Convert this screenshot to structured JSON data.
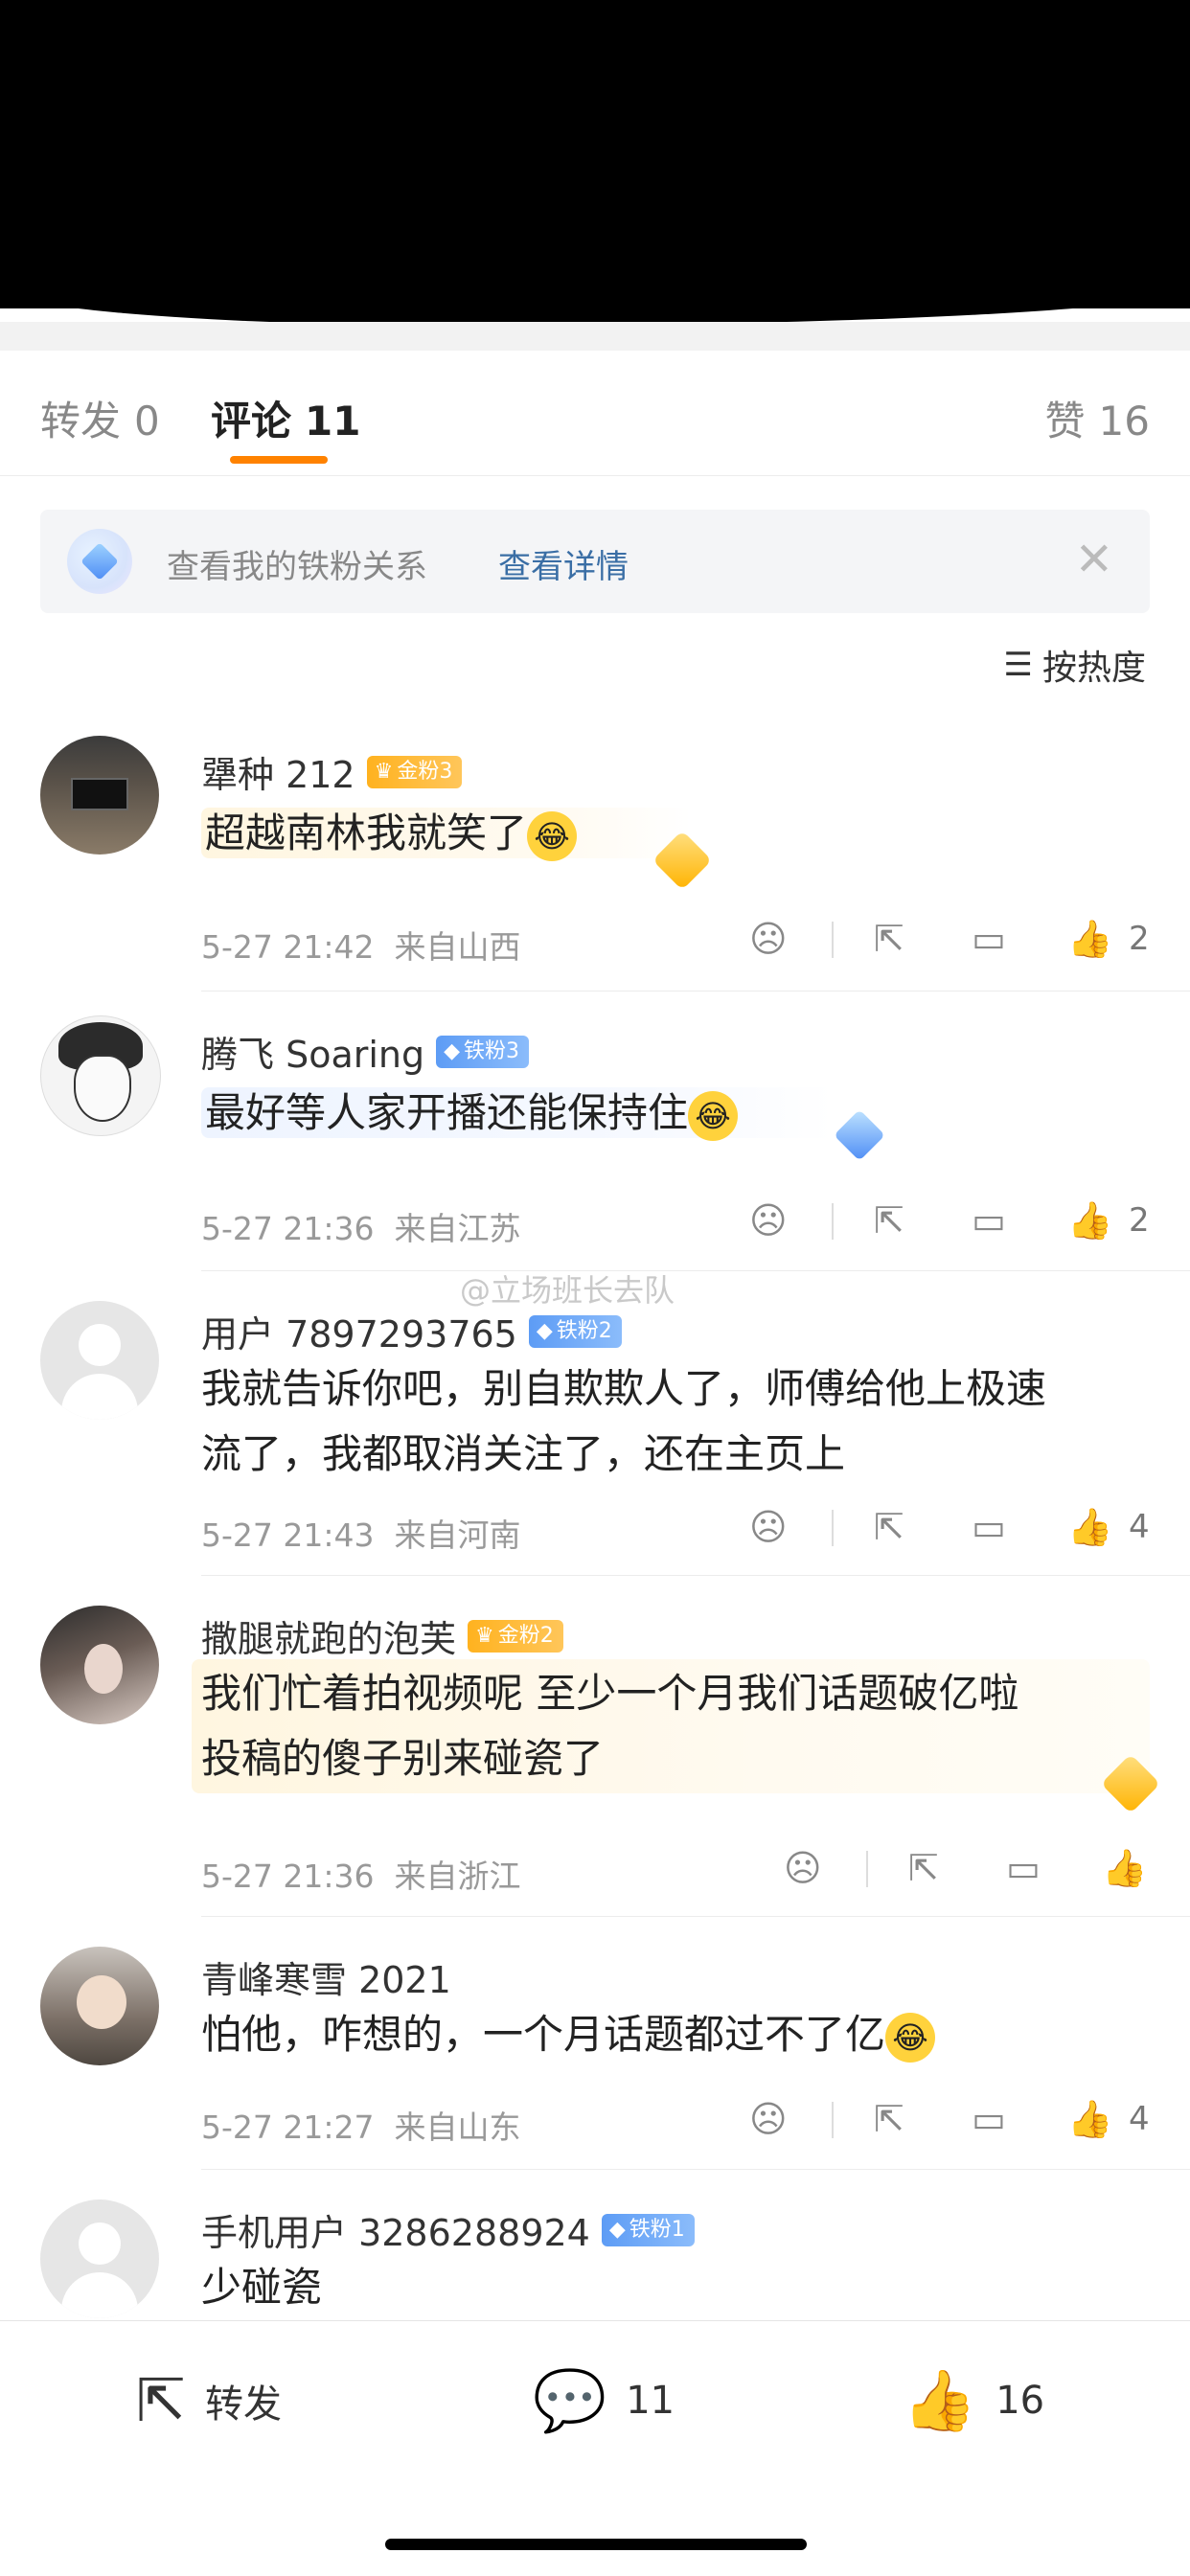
{
  "tabs": {
    "repost": {
      "label": "转发",
      "count": "0"
    },
    "comments": {
      "label": "评论",
      "count": "11"
    },
    "likes": {
      "label": "赞",
      "count": "16"
    }
  },
  "fan_banner": {
    "text": "查看我的铁粉关系",
    "link": "查看详情"
  },
  "sort": {
    "label": "按热度"
  },
  "watermark": "@立场班长去队",
  "comments": [
    {
      "name": "犟种 212",
      "badge": "金粉3",
      "badge_type": "gold",
      "text": [
        "超越南林我就笑了"
      ],
      "time": "5-27 21:42",
      "location": "来自山西",
      "likes": "2"
    },
    {
      "name": "腾飞 Soaring",
      "badge": "铁粉3",
      "badge_type": "iron",
      "text": [
        "最好等人家开播还能保持住"
      ],
      "time": "5-27 21:36",
      "location": "来自江苏",
      "likes": "2"
    },
    {
      "name": "用户 7897293765",
      "badge": "铁粉2",
      "badge_type": "iron",
      "text": [
        "我就告诉你吧，别自欺欺人了，师傅给他上极速",
        "流了，我都取消关注了，还在主页上"
      ],
      "time": "5-27 21:43",
      "location": "来自河南",
      "likes": "4"
    },
    {
      "name": "撒腿就跑的泡芙",
      "badge": "金粉2",
      "badge_type": "gold",
      "text": [
        "我们忙着拍视频呢 至少一个月我们话题破亿啦",
        "投稿的傻子别来碰瓷了"
      ],
      "time": "5-27 21:36",
      "location": "来自浙江",
      "likes": ""
    },
    {
      "name": "青峰寒雪 2021",
      "badge": "",
      "badge_type": "",
      "text": [
        "怕他，咋想的，一个月话题都过不了亿"
      ],
      "time": "5-27 21:27",
      "location": "来自山东",
      "likes": "4"
    },
    {
      "name": "手机用户 3286288924",
      "badge": "铁粉1",
      "badge_type": "iron",
      "text": [
        "少碰瓷"
      ],
      "time": "",
      "location": "",
      "likes": ""
    }
  ],
  "bottom_bar": {
    "repost_label": "转发",
    "comment_count": "11",
    "like_count": "16"
  },
  "icons": {
    "emoji": "laughing-crying-emoji",
    "dislike": "frown-face-icon",
    "share": "share-arrow-icon",
    "reply": "comment-bubble-icon",
    "like": "thumbs-up-icon"
  },
  "colors": {
    "accent": "#ff8200",
    "link": "#3a6ea5",
    "gold_badge": "#ffb21f",
    "iron_badge": "#5d9cf5"
  }
}
